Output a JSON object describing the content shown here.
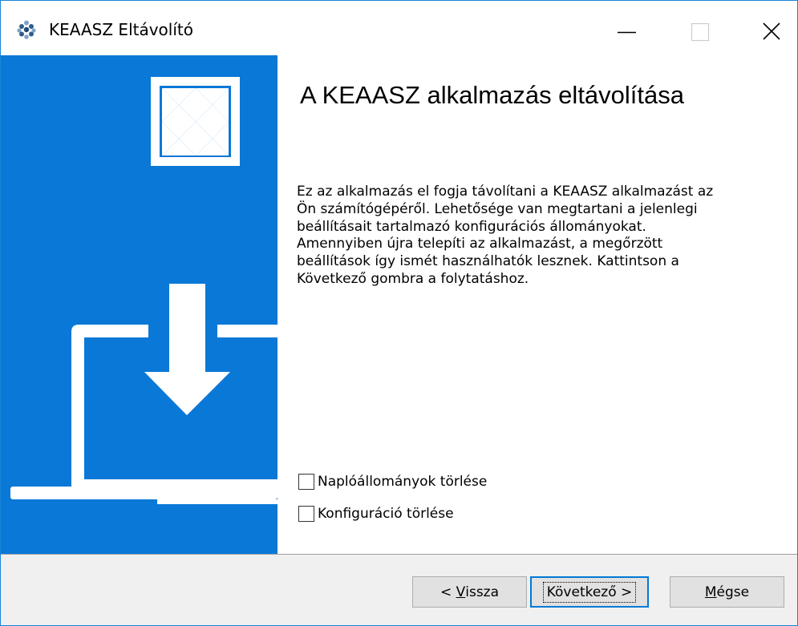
{
  "window": {
    "title": "KEAASZ Eltávolító",
    "icon": "keaasz-logo-icon",
    "controls": {
      "minimize_icon": "minimize-icon",
      "maximize_icon": "maximize-icon",
      "close_icon": "close-icon"
    }
  },
  "side_panel": {
    "background_color": "#0a78d7",
    "logo_icon": "keaasz-triangle-logo-icon",
    "illustration_icon": "laptop-download-icon"
  },
  "main": {
    "heading": "A KEAASZ alkalmazás eltávolítása",
    "description_lines": [
      "Ez az alkalmazás el fogja távolítani a KEAASZ alkalmazást az",
      "Ön számítógépéről. Lehetősége van megtartani a jelenlegi",
      "beállításait tartalmazó konfigurációs állományokat.",
      "Amennyiben újra telepíti az alkalmazást, a megőrzött",
      "beállítások így ismét használhatók lesznek. Kattintson a",
      "Következő gombra a folytatáshoz."
    ],
    "checkboxes": [
      {
        "label": "Naplóállományok törlése",
        "checked": false
      },
      {
        "label": "Konfiguráció törlése",
        "checked": false
      }
    ]
  },
  "footer": {
    "back": {
      "prefix": "< ",
      "mnemonic": "V",
      "rest": "issza"
    },
    "next_label": "Következő >",
    "cancel": {
      "mnemonic": "M",
      "rest": "égse"
    }
  },
  "colors": {
    "accent": "#0078d7",
    "footer_bg": "#f0f0f0",
    "button_bg": "#e1e1e1"
  }
}
